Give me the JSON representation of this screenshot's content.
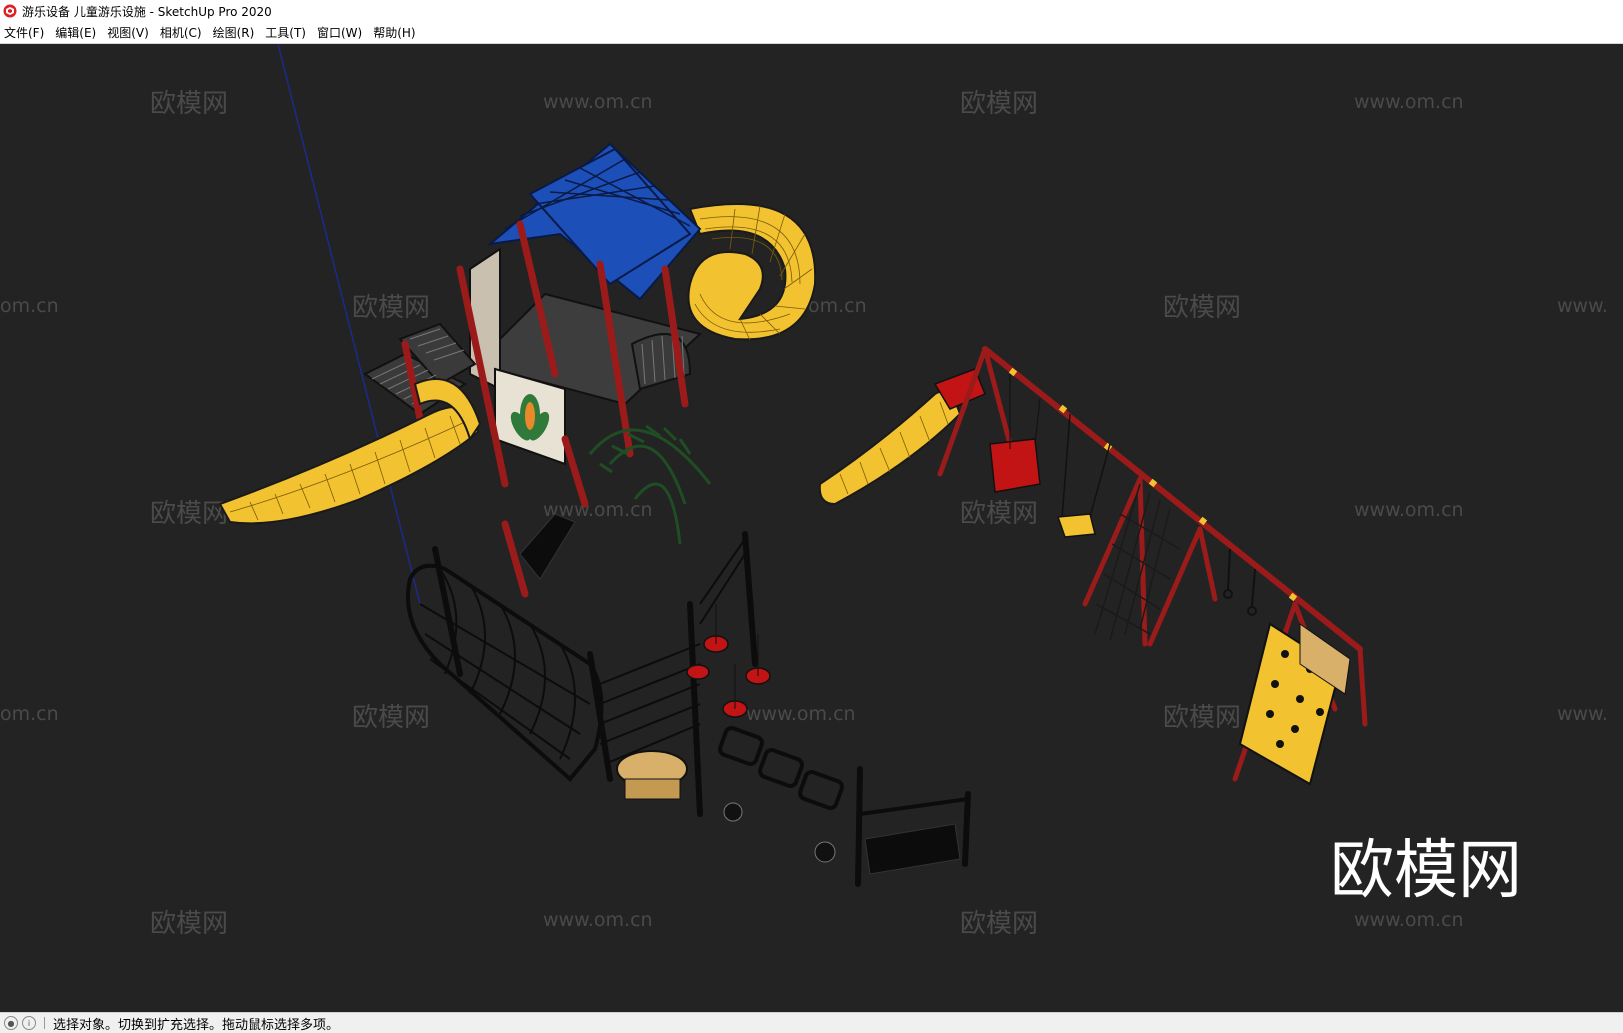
{
  "window": {
    "title": "游乐设备 儿童游乐设施 - SketchUp Pro 2020"
  },
  "menu": {
    "items": [
      {
        "label": "文件(F)",
        "name": "menu-file"
      },
      {
        "label": "编辑(E)",
        "name": "menu-edit"
      },
      {
        "label": "视图(V)",
        "name": "menu-view"
      },
      {
        "label": "相机(C)",
        "name": "menu-camera"
      },
      {
        "label": "绘图(R)",
        "name": "menu-draw"
      },
      {
        "label": "工具(T)",
        "name": "menu-tools"
      },
      {
        "label": "窗口(W)",
        "name": "menu-window"
      },
      {
        "label": "帮助(H)",
        "name": "menu-help"
      }
    ]
  },
  "watermark": {
    "logo_text": "欧模网",
    "url_text": "www.om.cn",
    "partial_url": "om.cn",
    "partial_www": "www."
  },
  "status": {
    "text": "选择对象。切换到扩充选择。拖动鼠标选择多项。",
    "icons": [
      "geo-location-icon",
      "info-icon"
    ]
  },
  "colors": {
    "viewport_bg": "#232323",
    "roof_blue": "#1d4fb8",
    "slide_yellow": "#f2c230",
    "frame_red": "#9b1b1b",
    "net_black": "#0c0c0c",
    "climb_green": "#1f4d24",
    "axis_blue": "#1c2a8a"
  }
}
